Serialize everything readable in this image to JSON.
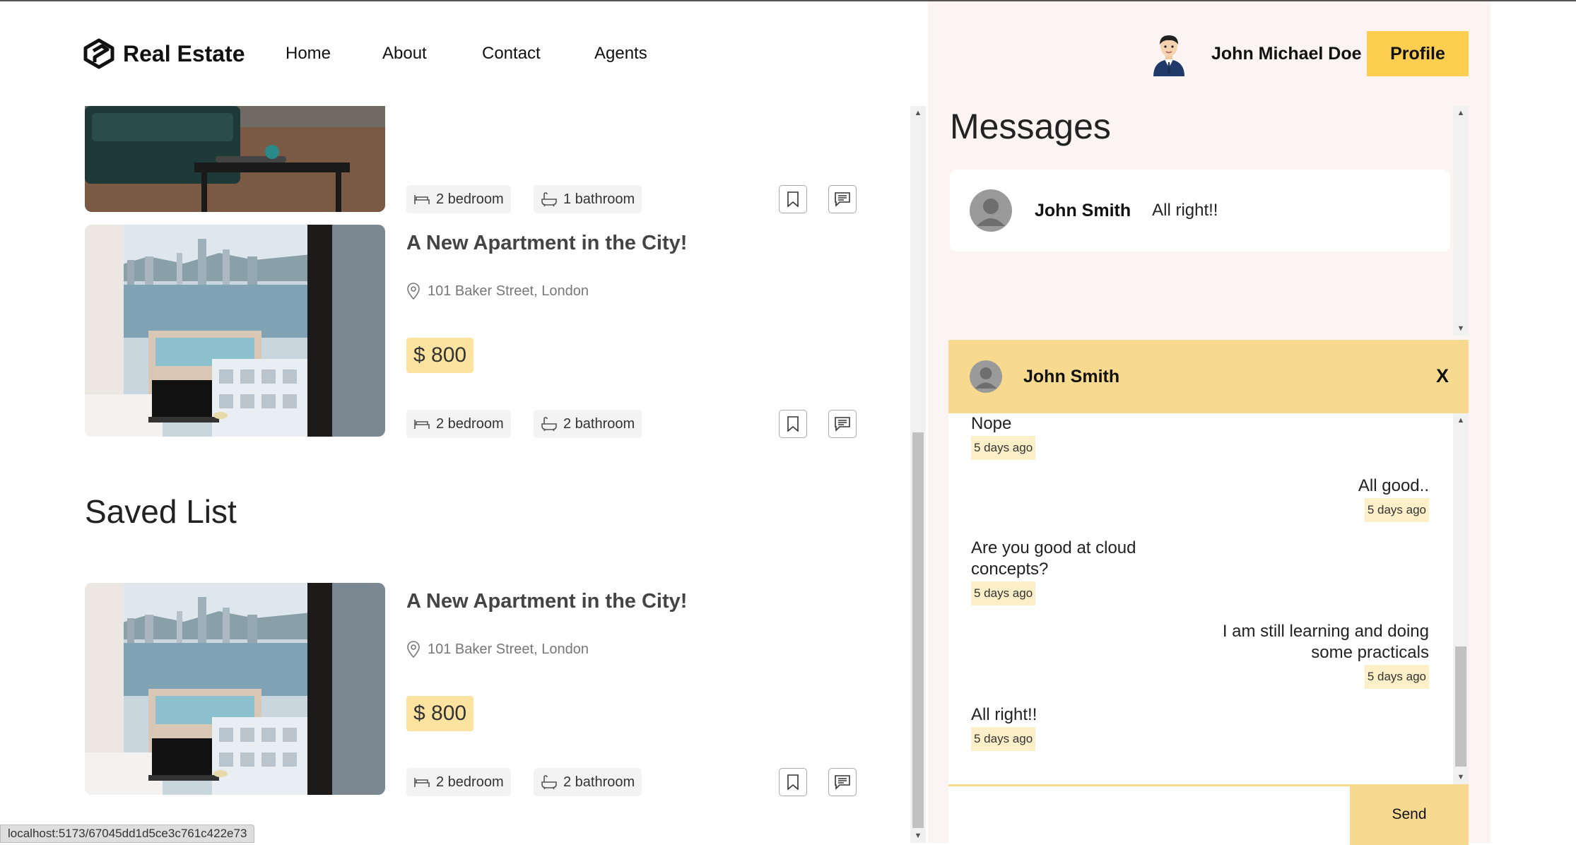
{
  "brand": {
    "name": "Real Estate"
  },
  "nav": {
    "home": "Home",
    "about": "About",
    "contact": "Contact",
    "agents": "Agents"
  },
  "user": {
    "name": "John Michael Doe",
    "profile_button": "Profile"
  },
  "listings": [
    {
      "bedrooms": "2 bedroom",
      "bathrooms": "1 bathroom"
    },
    {
      "title": "A New Apartment in the City!",
      "address": "101 Baker Street, London",
      "price": "$ 800",
      "bedrooms": "2 bedroom",
      "bathrooms": "2 bathroom"
    }
  ],
  "saved": {
    "heading": "Saved List",
    "items": [
      {
        "title": "A New Apartment in the City!",
        "address": "101 Baker Street, London",
        "price": "$ 800",
        "bedrooms": "2 bedroom",
        "bathrooms": "2 bathroom"
      }
    ]
  },
  "messages": {
    "heading": "Messages",
    "previews": [
      {
        "name": "John Smith",
        "text": "All right!!"
      }
    ]
  },
  "chat": {
    "contact": "John Smith",
    "close_label": "X",
    "messages": [
      {
        "text": "Nope",
        "time": "5 days ago",
        "side": "left"
      },
      {
        "text": "All good..",
        "time": "5 days ago",
        "side": "right"
      },
      {
        "text": "Are you good at cloud concepts?",
        "time": "5 days ago",
        "side": "left"
      },
      {
        "text": "I am still learning and doing some practicals",
        "time": "5 days ago",
        "side": "right"
      },
      {
        "text": "All right!!",
        "time": "5 days ago",
        "side": "left"
      }
    ],
    "send_label": "Send"
  },
  "status_bar": {
    "url": "localhost:5173/67045dd1d5ce3c761c422e73"
  },
  "colors": {
    "accent": "#fece51",
    "chat_header": "#f7d990",
    "price_bg": "#fde3a0",
    "panel_bg": "#fcf4f2"
  }
}
